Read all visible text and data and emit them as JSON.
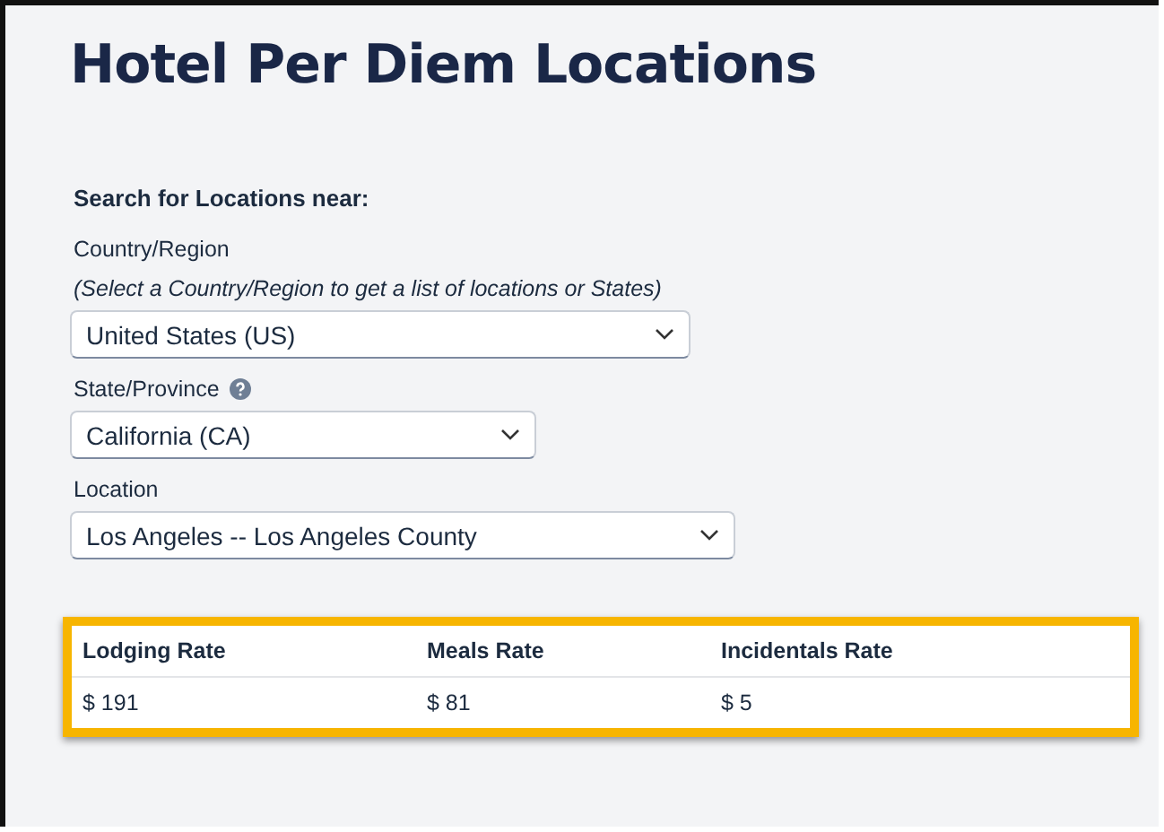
{
  "title": "Hotel Per Diem Locations",
  "search_heading": "Search for Locations near:",
  "fields": [
    {
      "label": "Country/Region",
      "hint": "(Select a Country/Region to get a list of locations or States)",
      "help": false,
      "value": "United States (US)"
    },
    {
      "label": "State/Province",
      "help": true,
      "value": "California (CA)"
    },
    {
      "label": "Location",
      "help": false,
      "value": "Los Angeles -- Los Angeles County"
    }
  ],
  "table": {
    "highlighted": true,
    "columns": [
      "Lodging Rate",
      "Meals Rate",
      "Incidentals Rate"
    ],
    "rows": [
      [
        "$ 191",
        "$ 81",
        "$ 5"
      ]
    ]
  }
}
